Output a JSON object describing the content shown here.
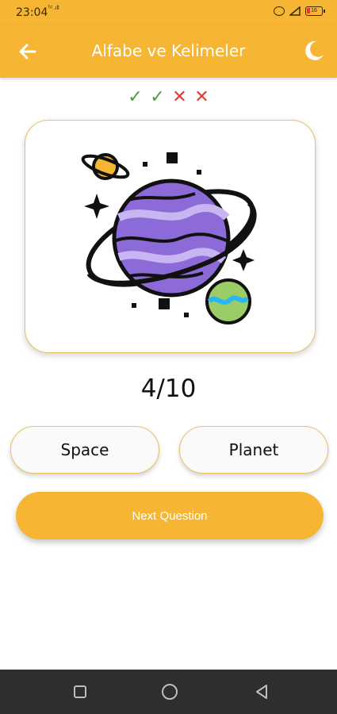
{
  "status_bar": {
    "time": "23:04",
    "network": "ᵀᵈ .ıll",
    "battery": "16"
  },
  "app_bar": {
    "title": "Alfabe ve Kelimeler",
    "back_icon": "arrow-left-icon",
    "theme_icon": "moon-icon"
  },
  "score": {
    "marks": [
      "✓",
      "✓",
      "✕",
      "✕"
    ],
    "results": [
      "correct",
      "correct",
      "wrong",
      "wrong"
    ]
  },
  "question": {
    "image_icon": "planet-illustration",
    "counter": "4/10"
  },
  "answers": {
    "options": [
      "Space",
      "Planet"
    ]
  },
  "actions": {
    "next_label": "Next Question"
  },
  "nav": {
    "icons": [
      "recent-apps-icon",
      "home-icon",
      "back-icon"
    ]
  },
  "colors": {
    "accent": "#f6b532",
    "correct": "#43a047",
    "wrong": "#e53935",
    "card_border": "#e8c163",
    "planet": "#8c6ad8",
    "nav_bg": "#2e2e2e"
  }
}
